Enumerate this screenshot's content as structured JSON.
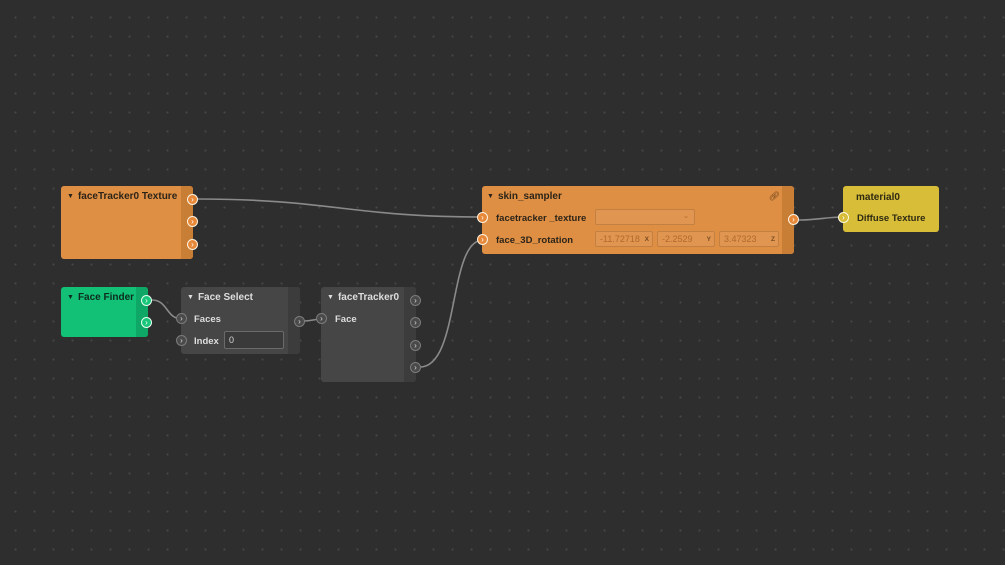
{
  "nodes": {
    "texture": {
      "title": "faceTracker0 Texture"
    },
    "skin": {
      "title": "skin_sampler",
      "inputs": {
        "texture_label": "facetracker _texture",
        "rotation_label": "face_3D_rotation"
      },
      "rotation": {
        "x": "-11.72718",
        "y": "-2.2529",
        "z": "3.47323"
      },
      "axes": {
        "x": "X",
        "y": "Y",
        "z": "Z"
      }
    },
    "material": {
      "title": "material0",
      "input_label": "Diffuse Texture"
    },
    "finder": {
      "title": "Face Finder"
    },
    "select": {
      "title": "Face Select",
      "faces_label": "Faces",
      "index_label": "Index",
      "index_value": "0"
    },
    "tracker": {
      "title": "faceTracker0",
      "face_label": "Face"
    }
  },
  "colors": {
    "orange": "#df8f43",
    "green": "#12c076",
    "gray": "#464646",
    "yellow": "#d7bd38",
    "wire": "#8a8a8a",
    "background": "#2e2e2e"
  },
  "icons": {
    "port": "arrow-right-icon",
    "collapse": "triangle-down-icon",
    "link": "link-icon",
    "dropdown": "chevron-down-icon"
  }
}
